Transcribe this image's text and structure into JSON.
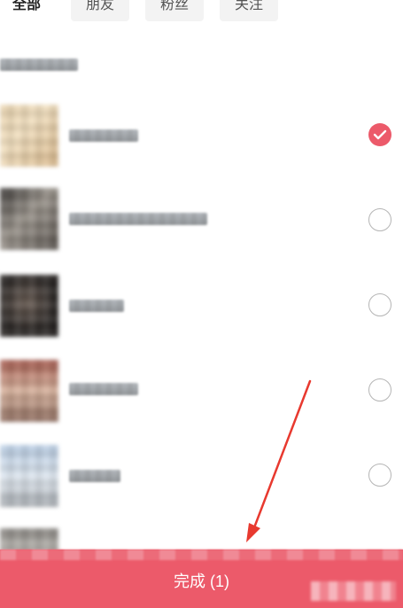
{
  "tabs": [
    {
      "label": "全部",
      "active": true
    },
    {
      "label": "朋友",
      "active": false
    },
    {
      "label": "粉丝",
      "active": false
    },
    {
      "label": "关注",
      "active": false
    }
  ],
  "contacts": [
    {
      "selected": true
    },
    {
      "selected": false
    },
    {
      "selected": false
    },
    {
      "selected": false
    },
    {
      "selected": false
    }
  ],
  "footer": {
    "done_label": "完成 (1)"
  },
  "colors": {
    "accent": "#ec5a6a",
    "annotation_arrow": "#e8392f"
  }
}
